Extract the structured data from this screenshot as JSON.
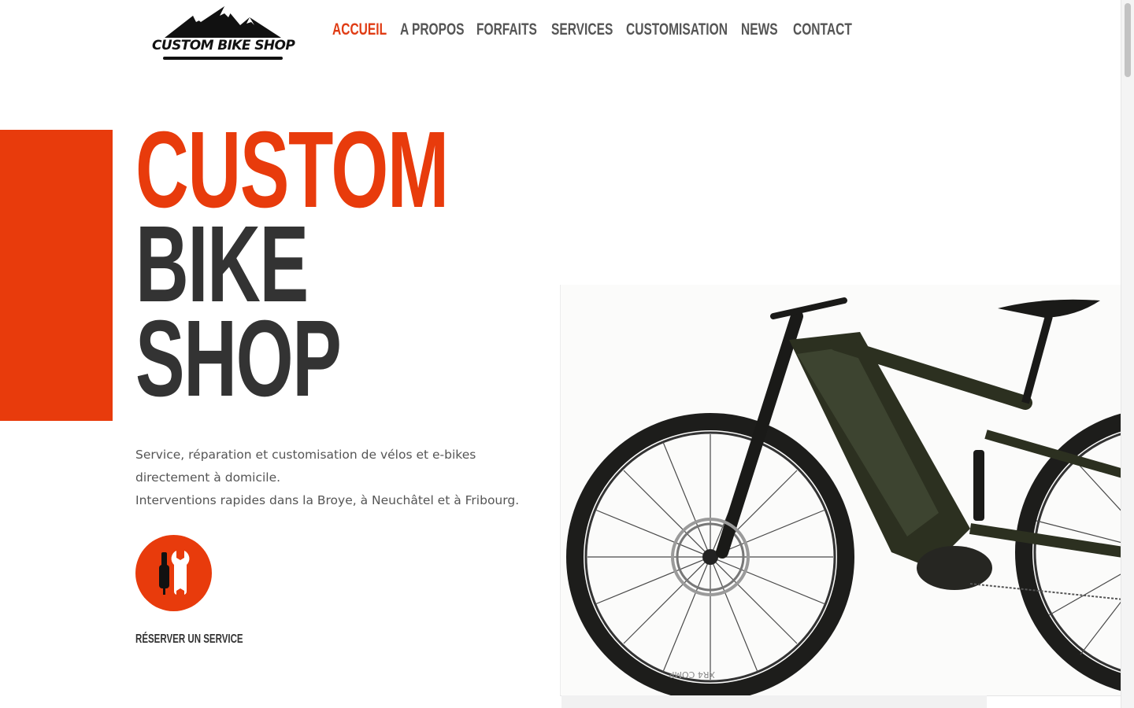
{
  "logo": {
    "text": "CUSTOM BIKE SHOP",
    "icon": "mountain-icon"
  },
  "nav": {
    "items": [
      {
        "label": "ACCUEIL",
        "active": true
      },
      {
        "label": "A PROPOS",
        "active": false
      },
      {
        "label": "FORFAITS",
        "active": false
      },
      {
        "label": "SERVICES",
        "active": false
      },
      {
        "label": "CUSTOMISATION",
        "active": false
      },
      {
        "label": "NEWS",
        "active": false
      },
      {
        "label": "CONTACT",
        "active": false
      }
    ]
  },
  "hero": {
    "title_line1": "CUSTOM",
    "title_line2": "BIKE",
    "title_line3": "SHOP",
    "description_line1": "Service, réparation et customisation de vélos et e-bikes directement à domicile.",
    "description_line2": "Interventions rapides dans la Broye, à Neuchâtel et à Fribourg.",
    "cta_icon": "screwdriver-wrench-icon",
    "cta_label": "RÉSERVER UN SERVICE"
  },
  "image": {
    "subject": "mountain-bike-photo",
    "tire_text": "XR4 COMP"
  },
  "colors": {
    "accent": "#e83b0c",
    "text_dark": "#333333",
    "text_body": "#555555",
    "nav_text": "#555555"
  }
}
